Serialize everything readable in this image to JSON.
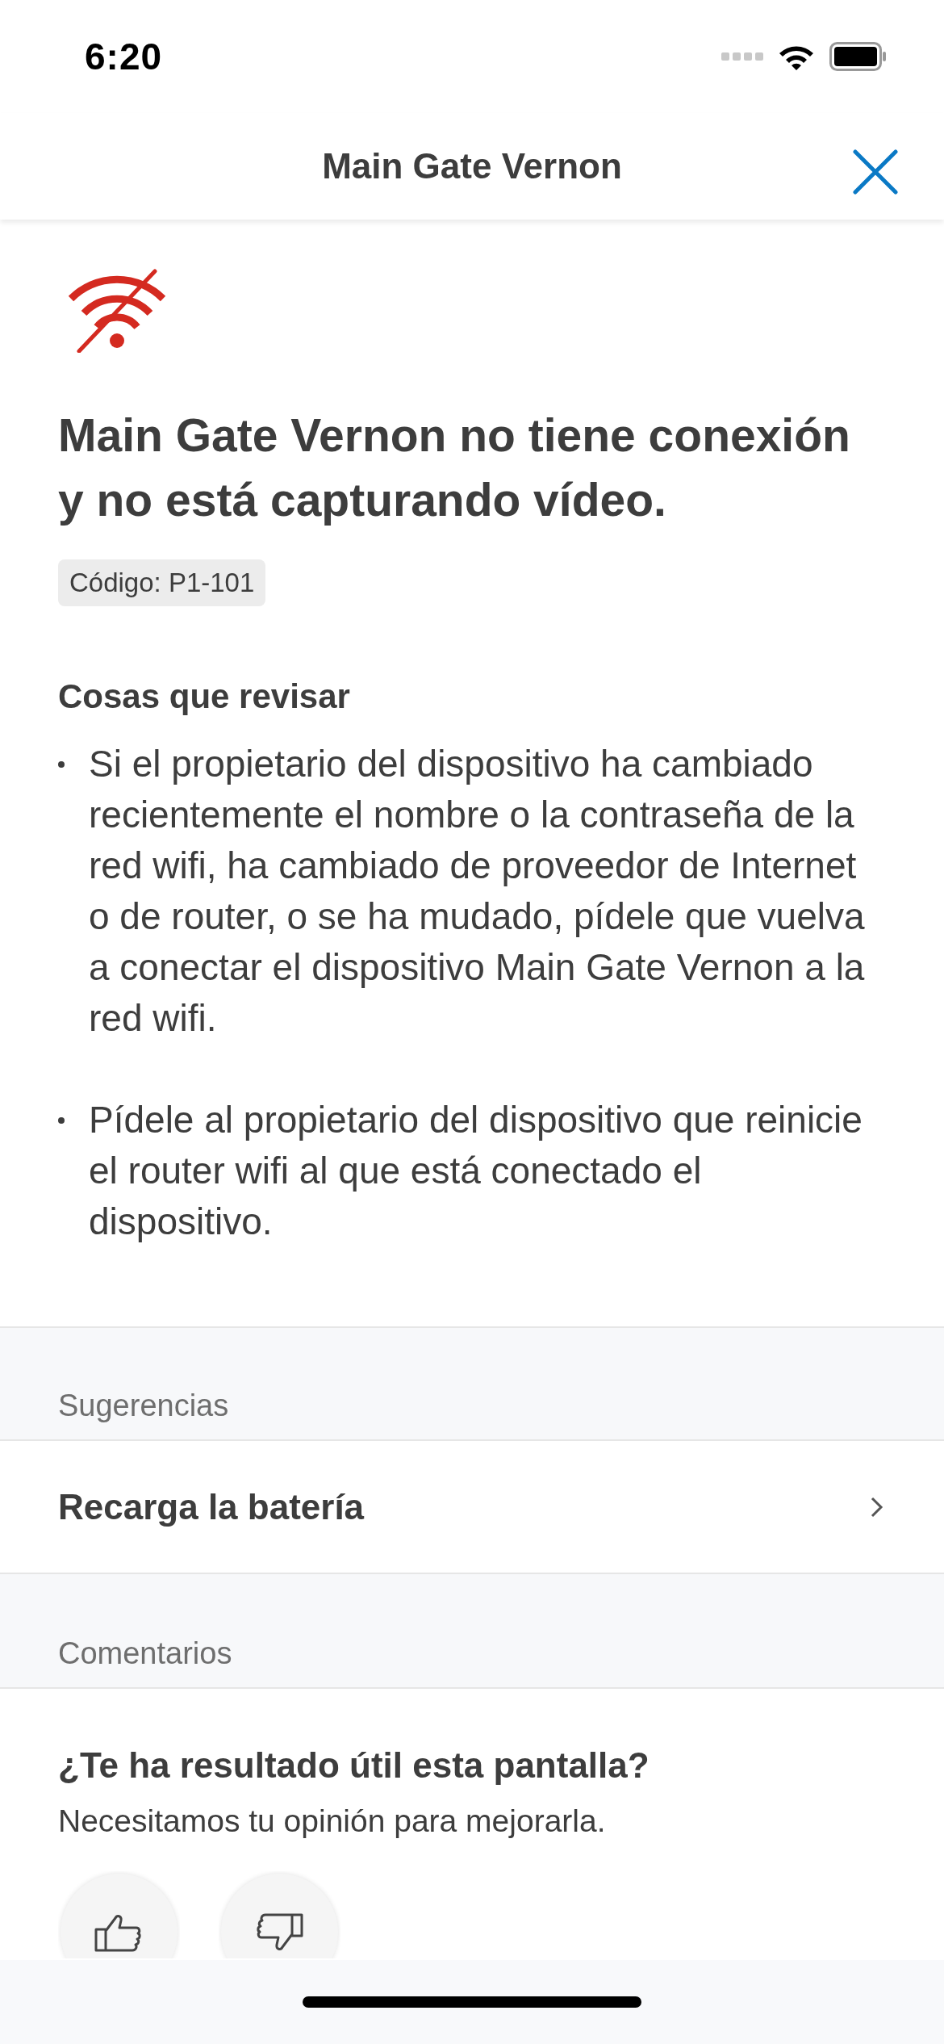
{
  "status_bar": {
    "time": "6:20"
  },
  "nav": {
    "title": "Main Gate Vernon"
  },
  "alert": {
    "heading": "Main Gate Vernon no tiene conexión y no está capturando vídeo.",
    "code": "Código: P1-101"
  },
  "checks": {
    "title": "Cosas que revisar",
    "items": [
      "Si el propietario del dispositivo ha cambiado recientemente el nombre o la contraseña de la red wifi, ha cambiado de proveedor de Internet o de router, o se ha mudado, pídele que vuelva a conectar el dispositivo Main Gate Vernon a la red wifi.",
      "Pídele al propietario del dispositivo que reinicie el router wifi al que está conectado el dispositivo."
    ]
  },
  "suggestions": {
    "header": "Sugerencias",
    "items": [
      {
        "label": "Recarga la batería"
      }
    ]
  },
  "feedback": {
    "header": "Comentarios",
    "question": "¿Te ha resultado útil esta pantalla?",
    "subtitle": "Necesitamos tu opinión para mejorarla.",
    "buttons": [
      {
        "kind": "up"
      },
      {
        "kind": "down"
      }
    ]
  }
}
